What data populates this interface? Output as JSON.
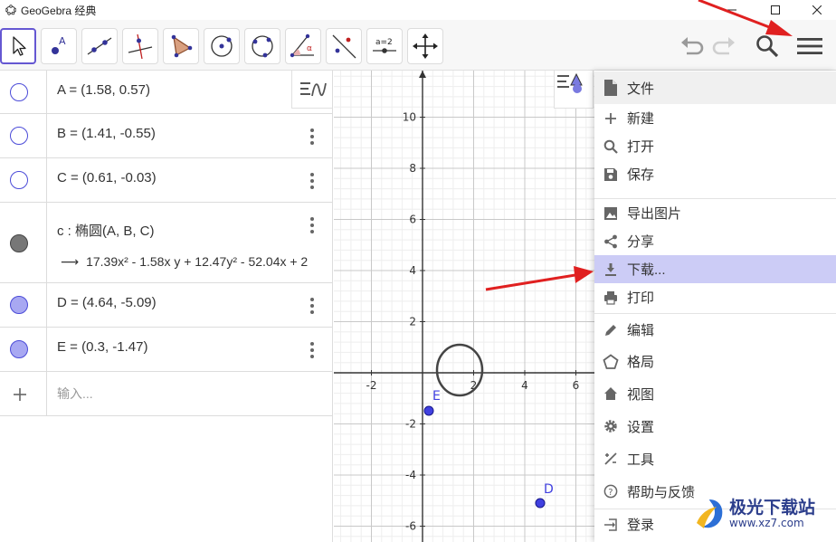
{
  "window": {
    "title": "GeoGebra 经典",
    "minimize_icon": "minimize-icon",
    "maximize_icon": "maximize-icon",
    "close_icon": "close-icon"
  },
  "toolbar": {
    "tools": [
      "move-tool-icon",
      "point-tool-icon",
      "line-tool-icon",
      "perpendicular-line-tool-icon",
      "polygon-tool-icon",
      "circle-center-point-tool-icon",
      "circle-three-points-tool-icon",
      "angle-tool-icon",
      "reflect-tool-icon",
      "slider-tool-icon",
      "move-graphics-view-tool-icon"
    ],
    "slider_label": "a=2",
    "angle_label": "α",
    "right": [
      "undo-icon",
      "redo-icon",
      "search-icon",
      "hamburger-menu-icon"
    ]
  },
  "algebra": {
    "rows": [
      {
        "text": "A = (1.58, 0.57)",
        "marble": "empty"
      },
      {
        "text": "B = (1.41, -0.55)",
        "marble": "empty"
      },
      {
        "text": "C = (0.61, -0.03)",
        "marble": "empty"
      },
      {
        "text": "c : 椭圆(A, B, C)",
        "sub": "17.39x² - 1.58x y + 12.47y² - 52.04x + 2",
        "marble": "dark"
      },
      {
        "text": "D = (4.64, -5.09)",
        "marble": "blue"
      },
      {
        "text": "E = (0.3, -1.47)",
        "marble": "blue"
      }
    ],
    "input_placeholder": "输入..."
  },
  "graphics": {
    "x_ticks": [
      "-2",
      "2",
      "4",
      "6"
    ],
    "y_ticks": [
      "10",
      "8",
      "6",
      "4",
      "2",
      "-2",
      "-4",
      "-6"
    ],
    "point_labels": [
      "E",
      "D"
    ]
  },
  "menu": {
    "items": [
      {
        "label": "文件",
        "icon": "file-icon"
      },
      {
        "label": "新建",
        "icon": "plus-icon"
      },
      {
        "label": "打开",
        "icon": "search-icon"
      },
      {
        "label": "保存",
        "icon": "save-icon"
      },
      {
        "label": "导出图片",
        "icon": "image-icon"
      },
      {
        "label": "分享",
        "icon": "share-icon"
      },
      {
        "label": "下载...",
        "icon": "download-icon"
      },
      {
        "label": "打印",
        "icon": "print-icon"
      },
      {
        "label": "编辑",
        "icon": "pencil-icon"
      },
      {
        "label": "格局",
        "icon": "perspectives-icon"
      },
      {
        "label": "视图",
        "icon": "home-icon"
      },
      {
        "label": "设置",
        "icon": "gear-icon"
      },
      {
        "label": "工具",
        "icon": "tools-icon"
      },
      {
        "label": "帮助与反馈",
        "icon": "help-icon"
      },
      {
        "label": "登录",
        "icon": "sign-in-icon"
      }
    ]
  },
  "watermark": {
    "title": "极光下载站",
    "url": "www.xz7.com"
  },
  "colors": {
    "accent": "#6557d2",
    "point_blue": "#4040e0",
    "highlight": "#ccccf6",
    "arrow_red": "#e02020"
  }
}
